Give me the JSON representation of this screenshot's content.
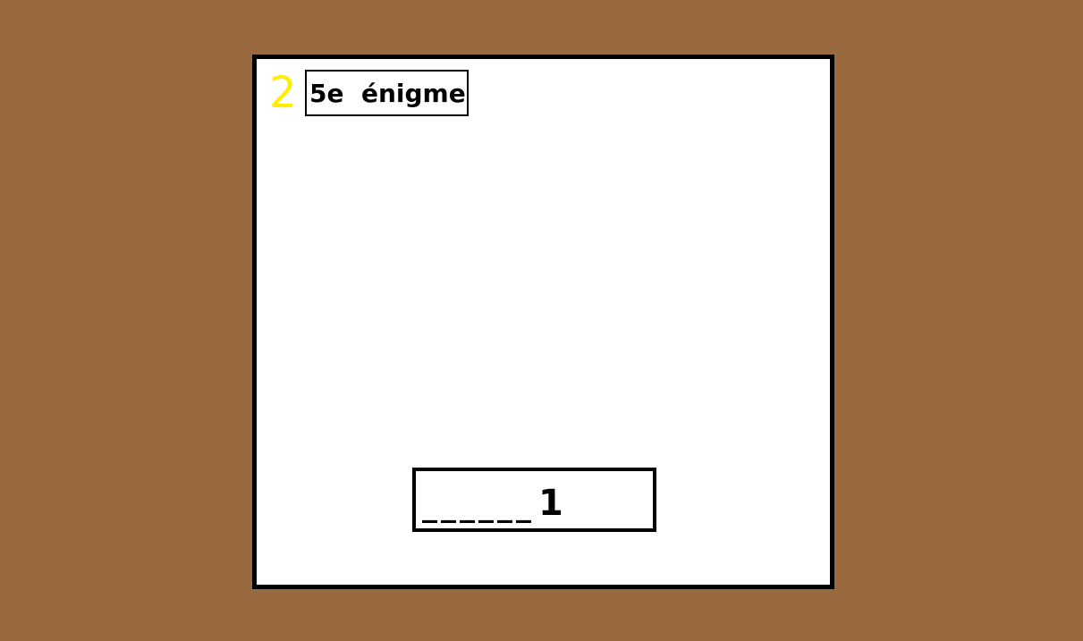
{
  "level": {
    "number": "2",
    "number_color": "#ffee00"
  },
  "title": {
    "text": "5e  énigme"
  },
  "answer": {
    "blanks": "______",
    "last_char": "1"
  },
  "colors": {
    "background": "#996a40",
    "panel": "#ffffff",
    "border": "#000000"
  }
}
